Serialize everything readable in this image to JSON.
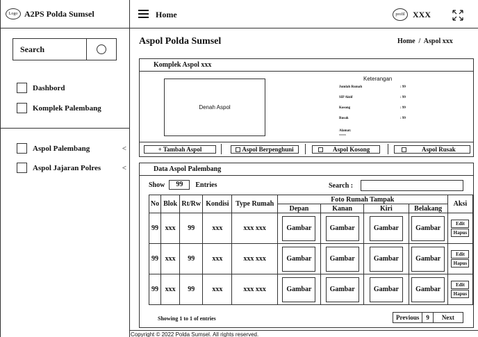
{
  "app": {
    "logo": "Logo",
    "title": "A2PS Polda Sumsel"
  },
  "topbar": {
    "home": "Home",
    "profil": "profil",
    "user": "XXX"
  },
  "sidebar": {
    "search": "Search",
    "items": [
      {
        "label": "Dashbord",
        "chevron": ""
      },
      {
        "label": "Komplek Palembang",
        "chevron": ""
      },
      {
        "label": "Aspol Palembang",
        "chevron": "<"
      },
      {
        "label": "Aspol Jajaran Polres",
        "chevron": "<"
      }
    ]
  },
  "page": {
    "title": "Aspol Polda Sumsel",
    "breadcrumb": "Home  /  Aspol xxx"
  },
  "komplek": {
    "title": "Komplek Aspol xxx",
    "denah": "Denah Aspol",
    "keterangan_title": "Keterangan",
    "rows": [
      {
        "label": "Jumlah Rumah",
        "value": ": 99"
      },
      {
        "label": "SIP Aktif",
        "value": ": 99"
      },
      {
        "label": "Kosong",
        "value": ": 99"
      },
      {
        "label": "Rusak",
        "value": ": 99"
      }
    ],
    "alamat_label": "Alamat:",
    "alamat_value": "xxxxx",
    "buttons": [
      "+ Tambah Aspol",
      "Aspol Berpenghuni",
      "Aspol Kosong",
      "Aspol Rusak"
    ]
  },
  "data": {
    "title": "Data Aspol Palembang",
    "show": "Show",
    "show_value": "99",
    "entries": "Entries",
    "search_label": "Search :",
    "columns": {
      "no": "No",
      "blok": "Blok",
      "rtrw": "Rt/Rw",
      "kondisi": "Kondisi",
      "type": "Type Rumah",
      "foto": "Foto Rumah Tampak",
      "depan": "Depan",
      "kanan": "Kanan",
      "kiri": "Kiri",
      "belakang": "Belakang",
      "aksi": "Aksi"
    },
    "rows": [
      {
        "no": "99",
        "blok": "xxx",
        "rtrw": "99",
        "kondisi": "xxx",
        "type": "xxx xxx",
        "g": "Gambar",
        "edit": "Edit",
        "hapus": "Hapus"
      },
      {
        "no": "99",
        "blok": "xxx",
        "rtrw": "99",
        "kondisi": "xxx",
        "type": "xxx xxx",
        "g": "Gambar",
        "edit": "Edit",
        "hapus": "Hapus"
      },
      {
        "no": "99",
        "blok": "xxx",
        "rtrw": "99",
        "kondisi": "xxx",
        "type": "xxx xxx",
        "g": "Gambar",
        "edit": "Edit",
        "hapus": "Hapus"
      }
    ],
    "showing": "Showing 1 to 1 of entries",
    "pager": {
      "prev": "Previous",
      "page": "9",
      "next": "Next"
    }
  },
  "footer": "Copyright © 2022 Polda Sumsel. All rights reserved."
}
